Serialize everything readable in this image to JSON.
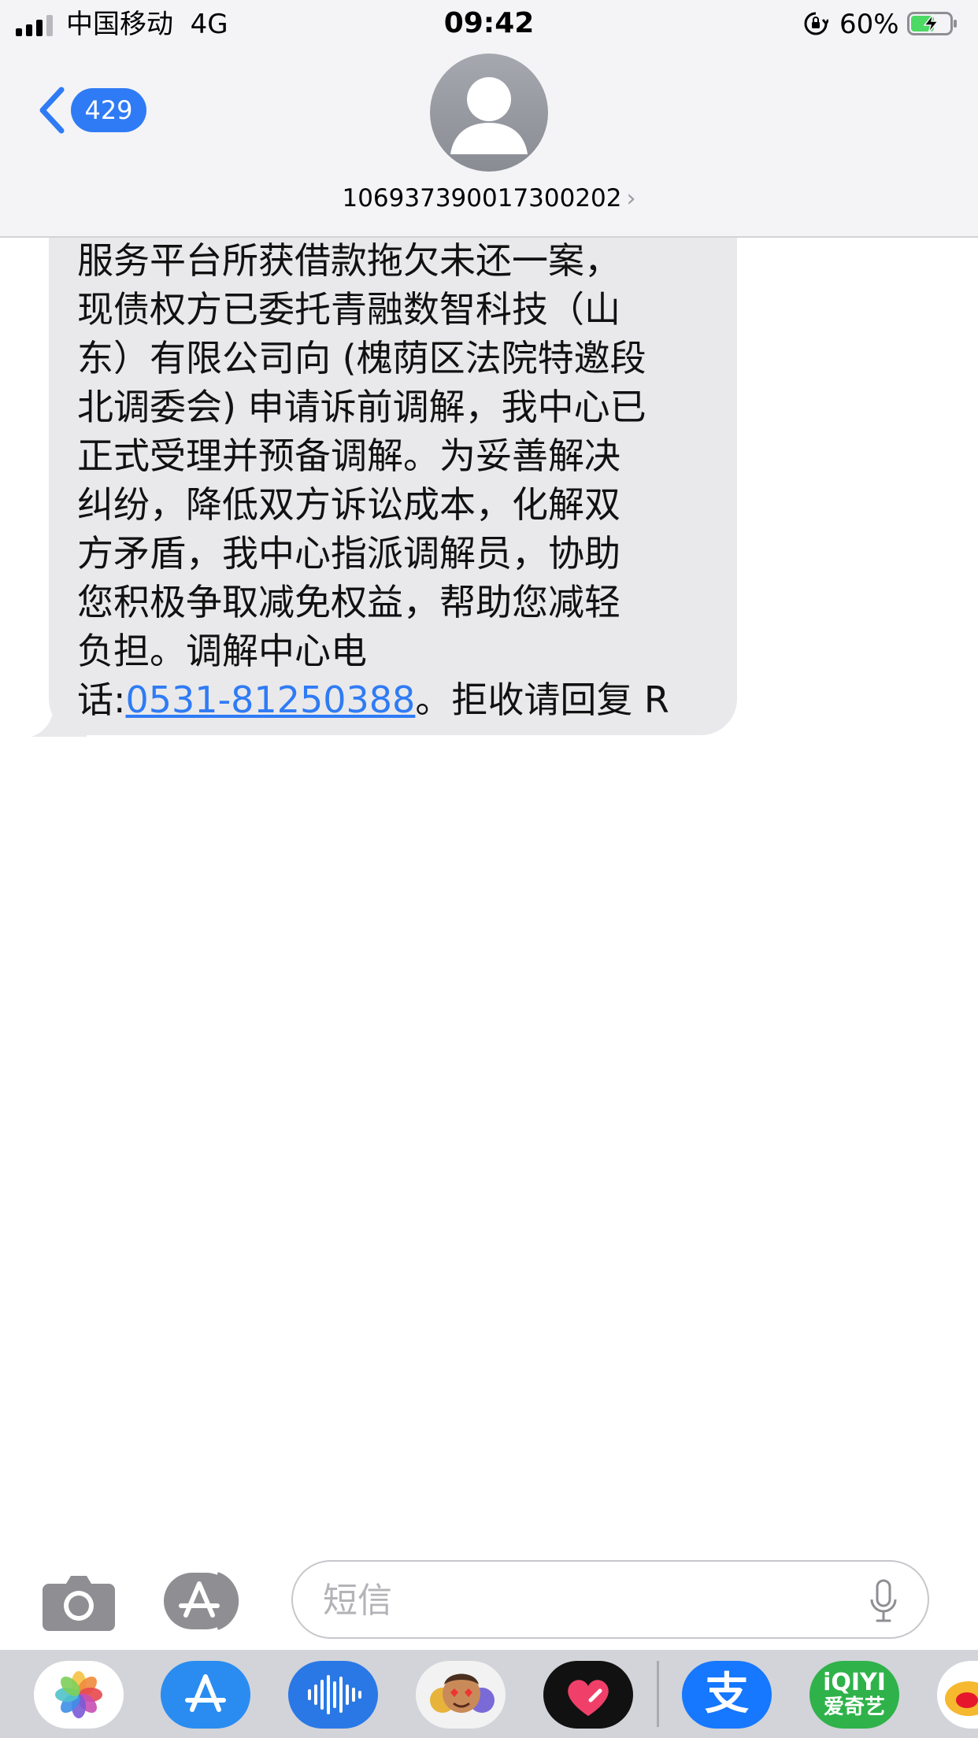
{
  "status_bar": {
    "carrier": "中国移动",
    "network": "4G",
    "time": "09:42",
    "battery_percent": "60%",
    "battery_level": 0.6,
    "charging": true
  },
  "nav": {
    "back_count": "429",
    "contact_number": "106937390017300202",
    "contact_chevron": "›"
  },
  "message": {
    "lines": [
      "服务平台所获借款拖欠未还一案，",
      "现债权方已委托青融数智科技（山",
      "东）有限公司向 (槐荫区法院特邀段",
      "北调委会) 申请诉前调解，我中心已",
      "正式受理并预备调解。为妥善解决",
      "纠纷，降低双方诉讼成本，化解双",
      "方矛盾，我中心指派调解员，协助",
      "您积极争取减免权益，帮助您减轻",
      "负担。调解中心电"
    ],
    "last_line_prefix": "话:",
    "phone": "0531-81250388",
    "last_line_suffix": "。拒收请回复 R"
  },
  "compose": {
    "placeholder": "短信"
  },
  "app_drawer": {
    "apps": [
      {
        "name": "photos-app-icon"
      },
      {
        "name": "app-store-app-icon"
      },
      {
        "name": "audio-app-icon"
      },
      {
        "name": "memoji-app-icon"
      },
      {
        "name": "digital-touch-app-icon"
      },
      {
        "name": "alipay-app-icon",
        "label": "支"
      },
      {
        "name": "iqiyi-app-icon",
        "label_top": "iQIYI",
        "label_bottom": "爱奇艺"
      },
      {
        "name": "weibo-app-icon"
      }
    ]
  },
  "colors": {
    "accent_blue": "#2f7bf5",
    "bubble_gray": "#e9e9eb",
    "header_gray": "#f4f4f6"
  }
}
